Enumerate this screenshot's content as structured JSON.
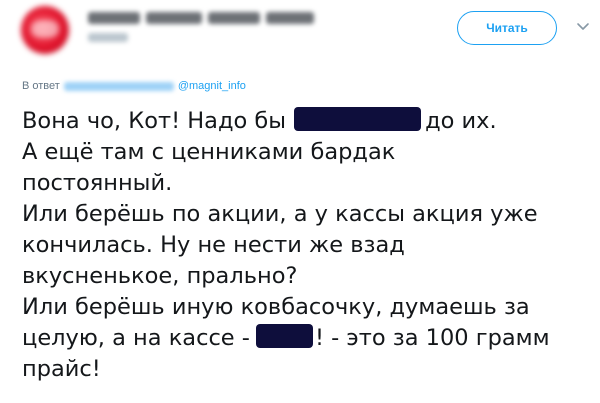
{
  "tweet": {
    "follow_label": "Читать",
    "reply_prefix": "В ответ",
    "reply_mention": "@magnit_info",
    "icons": {
      "caret": "chevron-down-icon"
    },
    "colors": {
      "accent": "#1da1f2",
      "redaction": "#0e0e3c",
      "text": "#14171a",
      "muted": "#657786"
    },
    "body": {
      "line1_a": "Вона чо, Кот! Надо бы",
      "line1_b": "до их.",
      "line2": "А ещё там с ценниками бардак",
      "line3": "постоянный.",
      "line4": "Или берёшь по акции, а у кассы акция уже",
      "line5": "кончилась. Ну не нести же взад",
      "line6": "вкусненькое, прально?",
      "line7": "Или берёшь иную ковбасочку, думаешь за",
      "line8_a": "целую, а на кассе -",
      "line8_b": "! - это за 100 грамм",
      "line9": "прайс!"
    }
  }
}
